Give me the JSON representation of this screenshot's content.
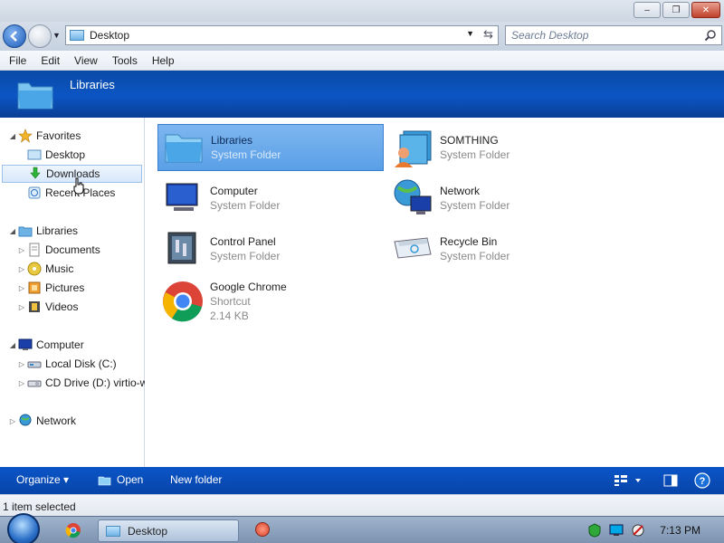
{
  "window": {
    "minimize_label": "–",
    "maximize_label": "❐",
    "close_label": "✕"
  },
  "address": {
    "path": "Desktop",
    "search_placeholder": "Search Desktop"
  },
  "menu": {
    "items": [
      "File",
      "Edit",
      "View",
      "Tools",
      "Help"
    ]
  },
  "header": {
    "title": "Libraries"
  },
  "navpane": {
    "favorites": "Favorites",
    "desktop": "Desktop",
    "downloads": "Downloads",
    "recent_places": "Recent Places",
    "libraries": "Libraries",
    "documents": "Documents",
    "music": "Music",
    "pictures": "Pictures",
    "videos": "Videos",
    "computer": "Computer",
    "local_disk": "Local Disk (C:)",
    "cd_drive": "CD Drive (D:) virtio-w",
    "network": "Network"
  },
  "content": {
    "items": [
      {
        "name": "Libraries",
        "sub": "System Folder"
      },
      {
        "name": "SOMTHING",
        "sub": "System Folder"
      },
      {
        "name": "Computer",
        "sub": "System Folder"
      },
      {
        "name": "Network",
        "sub": "System Folder"
      },
      {
        "name": "Control Panel",
        "sub": "System Folder"
      },
      {
        "name": "Recycle Bin",
        "sub": "System Folder"
      },
      {
        "name": "Google Chrome",
        "sub": "Shortcut",
        "size": "2.14 KB"
      }
    ]
  },
  "cmdbar": {
    "organize": "Organize ▾",
    "open": "Open",
    "new_folder": "New folder"
  },
  "status": {
    "text": "1 item selected"
  },
  "taskbar": {
    "task_label": "Desktop",
    "clock": "7:13 PM"
  },
  "colors": {
    "header_blue": "#0b55c4",
    "cmdbar_blue": "#0a55c8",
    "selection_blue": "#5a9fe6"
  }
}
